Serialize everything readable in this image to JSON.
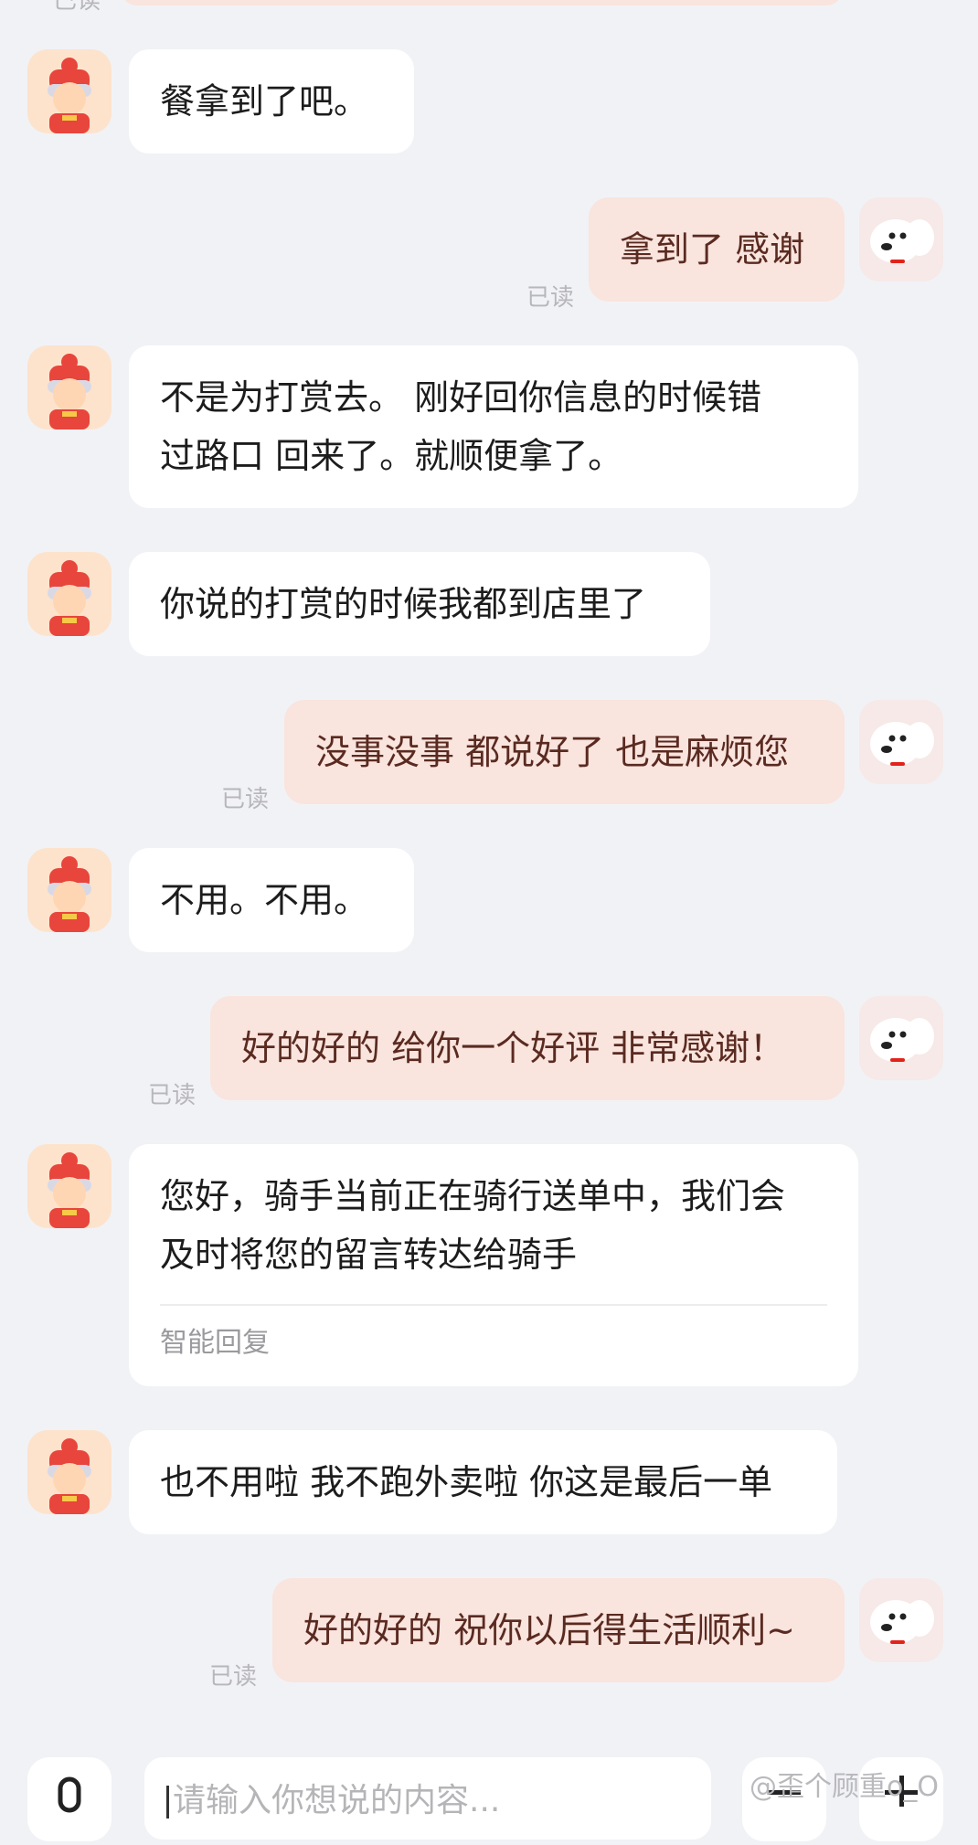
{
  "read_label": "已读",
  "messages": [
    {
      "from": "rider",
      "text": "餐拿到了吧。"
    },
    {
      "from": "me",
      "text": "拿到了 感谢",
      "read": "已读"
    },
    {
      "from": "rider",
      "text": "不是为打赏去。 刚好回你信息的时候错\n过路口 回来了。就顺便拿了。"
    },
    {
      "from": "rider",
      "text": "你说的打赏的时候我都到店里了"
    },
    {
      "from": "me",
      "text": "没事没事 都说好了 也是麻烦您",
      "read": "已读"
    },
    {
      "from": "rider",
      "text": "不用。不用。"
    },
    {
      "from": "me",
      "text": "好的好的 给你一个好评 非常感谢！",
      "read": "已读"
    },
    {
      "from": "rider",
      "text": "您好，骑手当前正在骑行送单中，我们会\n及时将您的留言转达给骑手",
      "tag": "智能回复"
    },
    {
      "from": "rider",
      "text": "也不用啦 我不跑外卖啦 你这是最后一单"
    },
    {
      "from": "me",
      "text": "好的好的 祝你以后得生活顺利~",
      "read": "已读"
    }
  ],
  "input": {
    "placeholder": "请输入你想说的内容..."
  },
  "watermark": "@歪个顾重o_O",
  "colors": {
    "background": "#f1f2f6",
    "incoming": "#ffffff",
    "outgoing": "#f9e4de"
  }
}
